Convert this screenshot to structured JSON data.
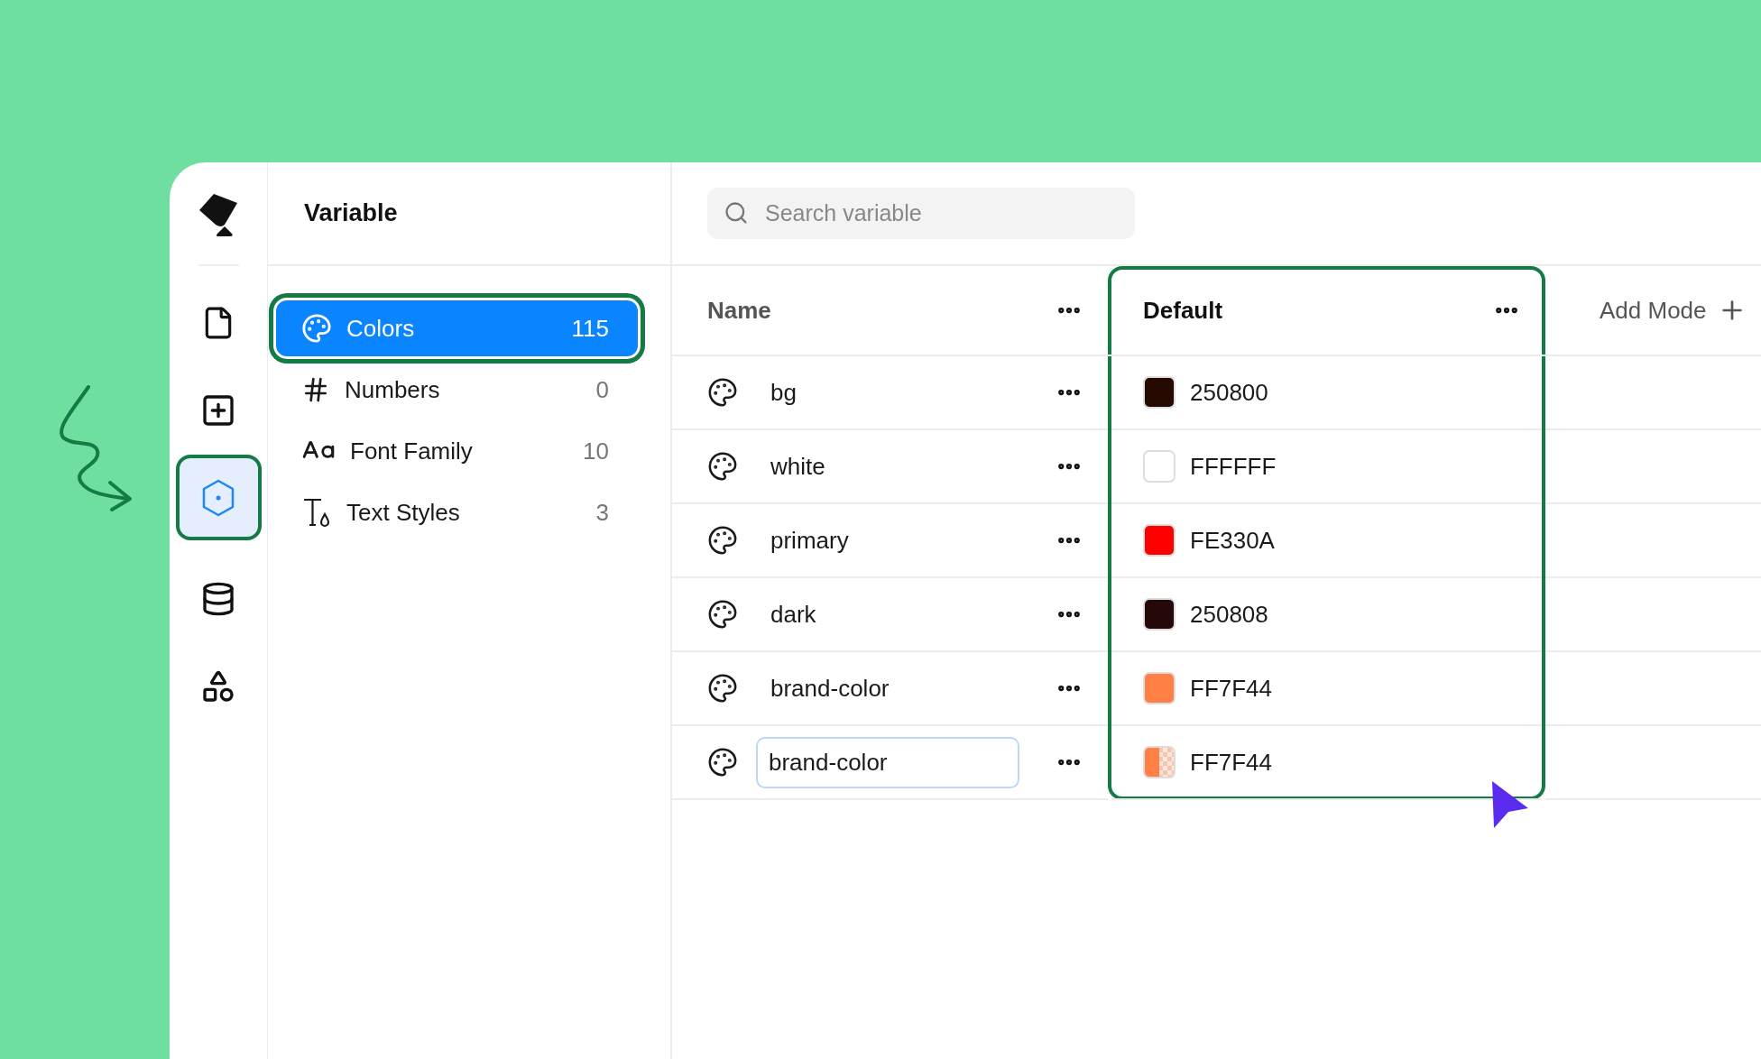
{
  "rail": {
    "items": [
      {
        "kind": "file",
        "selected": false
      },
      {
        "kind": "plus",
        "selected": false
      },
      {
        "kind": "hexagon",
        "selected": true
      },
      {
        "kind": "database",
        "selected": false
      },
      {
        "kind": "shapes",
        "selected": false
      }
    ]
  },
  "sidebar": {
    "title": "Variable",
    "items": [
      {
        "kind": "palette",
        "label": "Colors",
        "count": "115",
        "selected": true
      },
      {
        "kind": "hash",
        "label": "Numbers",
        "count": "0",
        "selected": false
      },
      {
        "kind": "font",
        "label": "Font Family",
        "count": "10",
        "selected": false
      },
      {
        "kind": "text-style",
        "label": "Text Styles",
        "count": "3",
        "selected": false
      }
    ]
  },
  "search": {
    "placeholder": "Search variable"
  },
  "table": {
    "columns": [
      {
        "label": "Name",
        "highlighted": false
      },
      {
        "label": "Default",
        "highlighted": true
      }
    ],
    "add_mode": "Add Mode",
    "rows": [
      {
        "name": "bg",
        "editing": false,
        "value": "250800",
        "color": "#250800",
        "kind": "solid"
      },
      {
        "name": "white",
        "editing": false,
        "value": "FFFFFF",
        "color": "#ffffff",
        "kind": "solid"
      },
      {
        "name": "primary",
        "editing": false,
        "value": "FE330A",
        "color": "#ff0000",
        "kind": "solid"
      },
      {
        "name": "dark",
        "editing": false,
        "value": "250808",
        "color": "#250808",
        "kind": "solid"
      },
      {
        "name": "brand-color",
        "editing": false,
        "value": "FF7F44",
        "color": "#ff7f44",
        "kind": "solid"
      },
      {
        "name": "brand-color",
        "editing": true,
        "value": "FF7F44",
        "color": "#ff7f44",
        "kind": "partial"
      }
    ]
  }
}
